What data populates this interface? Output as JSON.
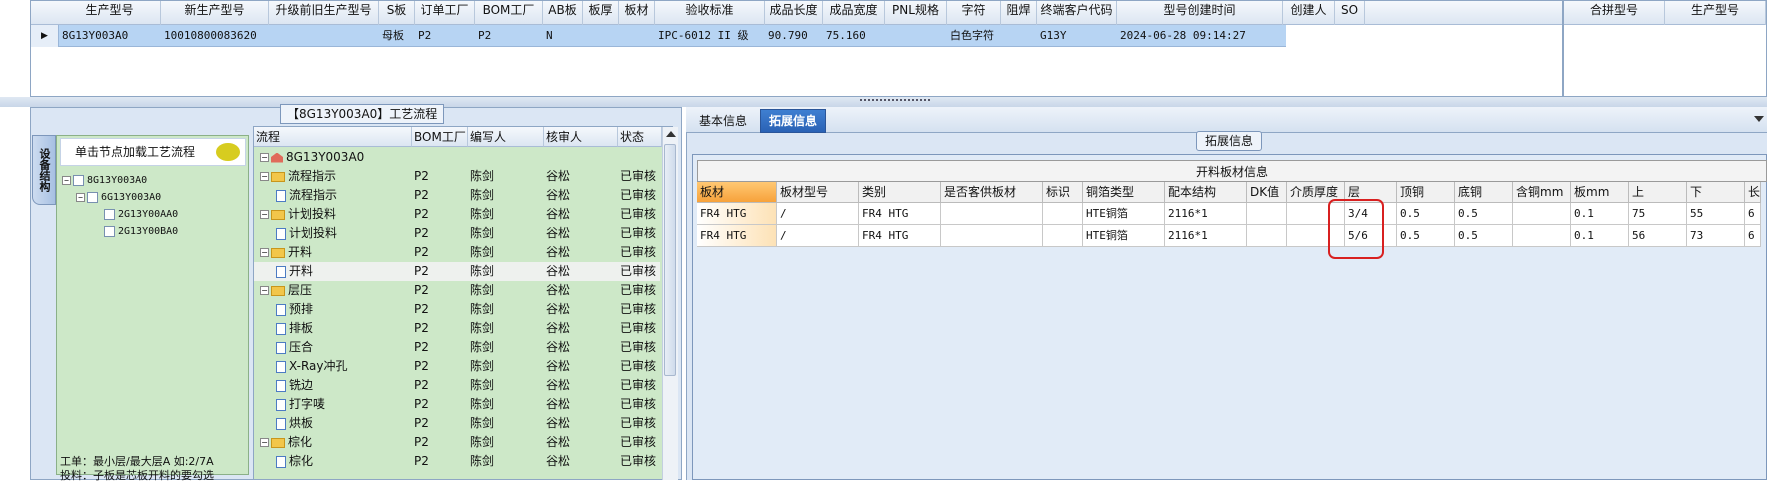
{
  "top_grid": {
    "columns": [
      "生产型号",
      "新生产型号",
      "升级前旧生产型号",
      "S板",
      "订单工厂",
      "BOM工厂",
      "AB板",
      "板厚",
      "板材",
      "验收标准",
      "成品长度",
      "成品宽度",
      "PNL规格",
      "字符",
      "阻焊",
      "终端客户代码",
      "型号创建时间",
      "创建人",
      "SO"
    ],
    "row": [
      "8G13Y003A0",
      "10010800083620",
      "",
      "母板",
      "P2",
      "P2",
      "N",
      "",
      "",
      "IPC-6012 II 级",
      "90.790",
      "75.160",
      "",
      "白色字符",
      "",
      "G13Y",
      "2024-06-28 09:14:27",
      "",
      ""
    ],
    "row_indicator": "▶"
  },
  "right_top": {
    "columns": [
      "合拼型号",
      "生产型号"
    ]
  },
  "left_panel": {
    "title": "【8G13Y003A0】工艺流程",
    "vertical_tab": "设备结构",
    "nav_header": "单击节点加载工艺流程",
    "nav_tree": [
      "8G13Y003A0",
      "6G13Y003A0",
      "2G13Y00AA0",
      "2G13Y00BA0"
    ],
    "notes": [
      "工单：最小层/最大层A 如:2/7A",
      "投料：子板是芯板开料的要勾选"
    ]
  },
  "flow_grid": {
    "columns": [
      "流程",
      "BOM工厂",
      "编写人",
      "核审人",
      "状态"
    ],
    "rows": [
      {
        "name": "8G13Y003A0",
        "bom": "",
        "writer": "",
        "reviewer": "",
        "status": "",
        "level": 0,
        "icon": "home"
      },
      {
        "name": "流程指示",
        "bom": "P2",
        "writer": "陈剑",
        "reviewer": "谷松",
        "status": "已审核",
        "level": 1,
        "icon": "folder"
      },
      {
        "name": "流程指示",
        "bom": "P2",
        "writer": "陈剑",
        "reviewer": "谷松",
        "status": "已审核",
        "level": 2,
        "icon": "doc"
      },
      {
        "name": "计划投料",
        "bom": "P2",
        "writer": "陈剑",
        "reviewer": "谷松",
        "status": "已审核",
        "level": 1,
        "icon": "folder"
      },
      {
        "name": "计划投料",
        "bom": "P2",
        "writer": "陈剑",
        "reviewer": "谷松",
        "status": "已审核",
        "level": 2,
        "icon": "doc"
      },
      {
        "name": "开料",
        "bom": "P2",
        "writer": "陈剑",
        "reviewer": "谷松",
        "status": "已审核",
        "level": 1,
        "icon": "folder"
      },
      {
        "name": "开料",
        "bom": "P2",
        "writer": "陈剑",
        "reviewer": "谷松",
        "status": "已审核",
        "level": 2,
        "icon": "doc",
        "selected": true
      },
      {
        "name": "层压",
        "bom": "P2",
        "writer": "陈剑",
        "reviewer": "谷松",
        "status": "已审核",
        "level": 1,
        "icon": "folder"
      },
      {
        "name": "预排",
        "bom": "P2",
        "writer": "陈剑",
        "reviewer": "谷松",
        "status": "已审核",
        "level": 2,
        "icon": "doc"
      },
      {
        "name": "排板",
        "bom": "P2",
        "writer": "陈剑",
        "reviewer": "谷松",
        "status": "已审核",
        "level": 2,
        "icon": "doc"
      },
      {
        "name": "压合",
        "bom": "P2",
        "writer": "陈剑",
        "reviewer": "谷松",
        "status": "已审核",
        "level": 2,
        "icon": "doc"
      },
      {
        "name": "X-Ray冲孔",
        "bom": "P2",
        "writer": "陈剑",
        "reviewer": "谷松",
        "status": "已审核",
        "level": 2,
        "icon": "doc"
      },
      {
        "name": "铣边",
        "bom": "P2",
        "writer": "陈剑",
        "reviewer": "谷松",
        "status": "已审核",
        "level": 2,
        "icon": "doc"
      },
      {
        "name": "打字唛",
        "bom": "P2",
        "writer": "陈剑",
        "reviewer": "谷松",
        "status": "已审核",
        "level": 2,
        "icon": "doc"
      },
      {
        "name": "烘板",
        "bom": "P2",
        "writer": "陈剑",
        "reviewer": "谷松",
        "status": "已审核",
        "level": 2,
        "icon": "doc"
      },
      {
        "name": "棕化",
        "bom": "P2",
        "writer": "陈剑",
        "reviewer": "谷松",
        "status": "已审核",
        "level": 1,
        "icon": "folder"
      },
      {
        "name": "棕化",
        "bom": "P2",
        "writer": "陈剑",
        "reviewer": "谷松",
        "status": "已审核",
        "level": 2,
        "icon": "doc"
      }
    ]
  },
  "right_panel": {
    "tabs": [
      "基本信息",
      "拓展信息"
    ],
    "active_tab": 1,
    "section_label": "拓展信息",
    "table_title": "开料板材信息",
    "columns": [
      "板材",
      "板材型号",
      "类别",
      "是否客供板材",
      "标识",
      "铜箔类型",
      "配本结构",
      "DK值",
      "介质厚度",
      "层",
      "顶铜",
      "底铜",
      "含铜mm",
      "板mm",
      "上",
      "下",
      "长"
    ],
    "rows": [
      [
        "FR4 HTG",
        "/",
        "FR4 HTG",
        "",
        "",
        "HTE铜箔",
        "2116*1",
        "",
        "",
        "3/4",
        "0.5",
        "0.5",
        "",
        "0.1",
        "75",
        "55",
        "6"
      ],
      [
        "FR4 HTG",
        "/",
        "FR4 HTG",
        "",
        "",
        "HTE铜箔",
        "2116*1",
        "",
        "",
        "5/6",
        "0.5",
        "0.5",
        "",
        "0.1",
        "56",
        "73",
        "6"
      ]
    ]
  }
}
